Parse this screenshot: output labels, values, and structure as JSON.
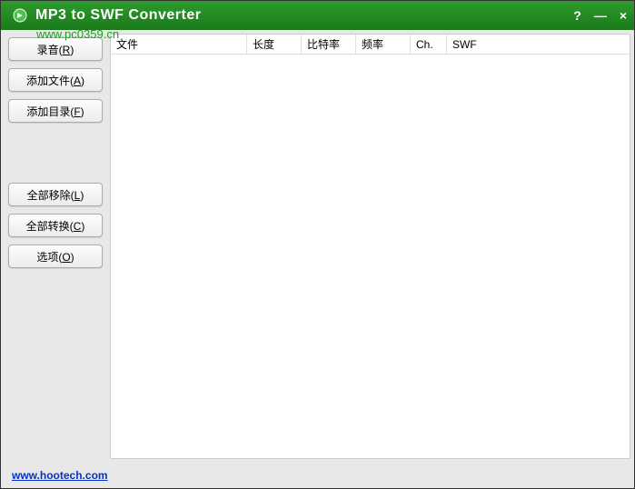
{
  "titlebar": {
    "title": "MP3 to SWF Converter",
    "help": "?",
    "minimize": "—",
    "close": "×"
  },
  "watermark_url": "www.pc0359.cn",
  "sidebar": {
    "record": "录音(R)",
    "add_file": "添加文件(A)",
    "add_folder": "添加目录(F)",
    "remove_all": "全部移除(L)",
    "convert_all": "全部转换(C)",
    "options": "选项(O)"
  },
  "table": {
    "headers": {
      "file": "文件",
      "length": "长度",
      "bitrate": "比特率",
      "frequency": "频率",
      "channels": "Ch.",
      "swf": "SWF"
    }
  },
  "footer": {
    "link_text": "www.hootech.com"
  }
}
